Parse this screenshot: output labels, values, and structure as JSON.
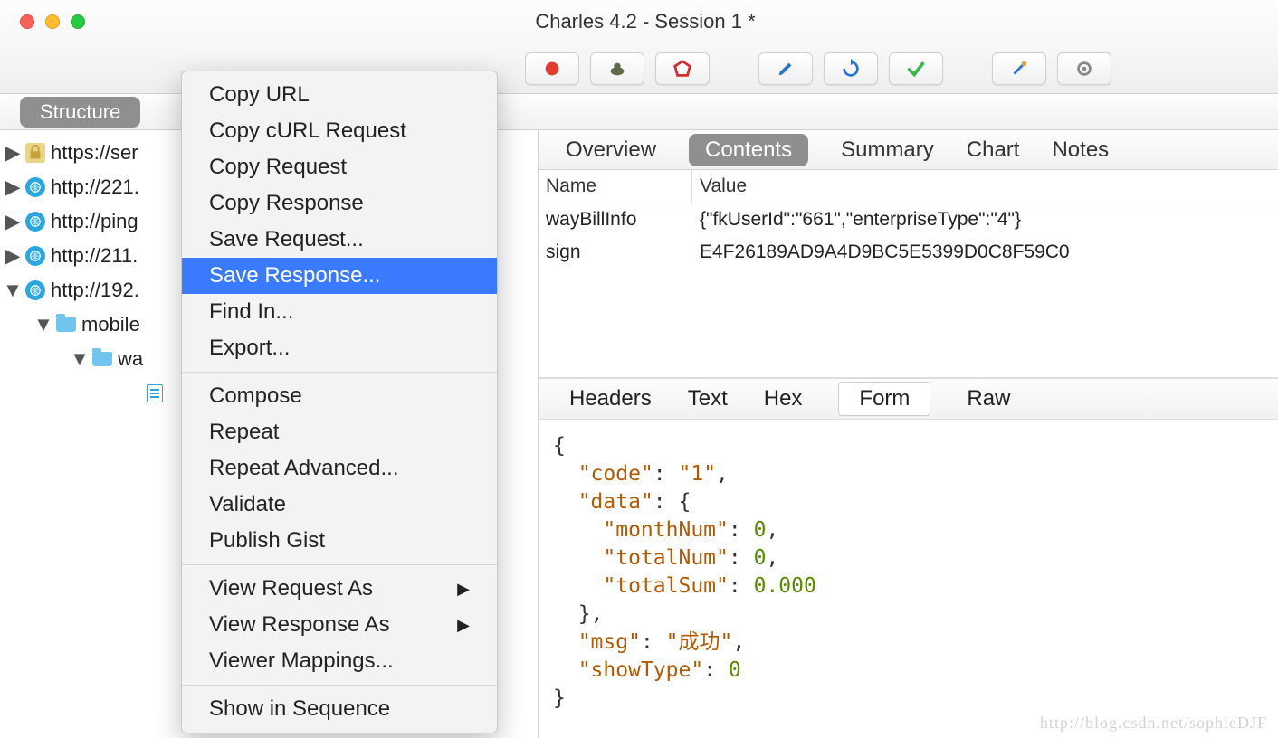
{
  "window": {
    "title": "Charles 4.2 - Session 1 *"
  },
  "sidebar_tab": "Structure",
  "tree": [
    {
      "icon": "lock",
      "label": "https://ser",
      "disclosure": "▶"
    },
    {
      "icon": "globe",
      "label": "http://221.",
      "disclosure": "▶"
    },
    {
      "icon": "globe",
      "label": "http://ping",
      "disclosure": "▶"
    },
    {
      "icon": "globe",
      "label": "http://211.",
      "disclosure": "▶"
    },
    {
      "icon": "globe",
      "label": "http://192.",
      "disclosure": "▼"
    },
    {
      "icon": "folder",
      "label": "mobile",
      "disclosure": "▼",
      "indent": 1
    },
    {
      "icon": "folder",
      "label": "wa",
      "disclosure": "▼",
      "indent": 2
    },
    {
      "icon": "file",
      "label": "",
      "disclosure": "",
      "indent": 3
    }
  ],
  "context_menu": {
    "groups": [
      [
        "Copy URL",
        "Copy cURL Request",
        "Copy Request",
        "Copy Response",
        "Save Request...",
        "Save Response...",
        "Find In...",
        "Export..."
      ],
      [
        "Compose",
        "Repeat",
        "Repeat Advanced...",
        "Validate",
        "Publish Gist"
      ],
      [
        "View Request As",
        "View Response As",
        "Viewer Mappings..."
      ],
      [
        "Show in Sequence"
      ]
    ],
    "highlighted": "Save Response...",
    "submenu_items": [
      "View Request As",
      "View Response As"
    ]
  },
  "main_tabs": [
    "Overview",
    "Contents",
    "Summary",
    "Chart",
    "Notes"
  ],
  "main_tab_active": "Contents",
  "kv": {
    "headers": {
      "name": "Name",
      "value": "Value"
    },
    "rows": [
      {
        "name": "wayBillInfo",
        "value": "{\"fkUserId\":\"661\",\"enterpriseType\":\"4\"}"
      },
      {
        "name": "sign",
        "value": "E4F26189AD9A4D9BC5E5399D0C8F59C0"
      }
    ]
  },
  "sub_tabs": [
    "Headers",
    "Text",
    "Hex",
    "Form",
    "Raw"
  ],
  "sub_tab_active": "Form",
  "json_response": {
    "code": "1",
    "data": {
      "monthNum": 0,
      "totalNum": 0,
      "totalSum": "0.000"
    },
    "msg": "成功",
    "showType": 0
  },
  "watermark": "http://blog.csdn.net/sophieDJF"
}
